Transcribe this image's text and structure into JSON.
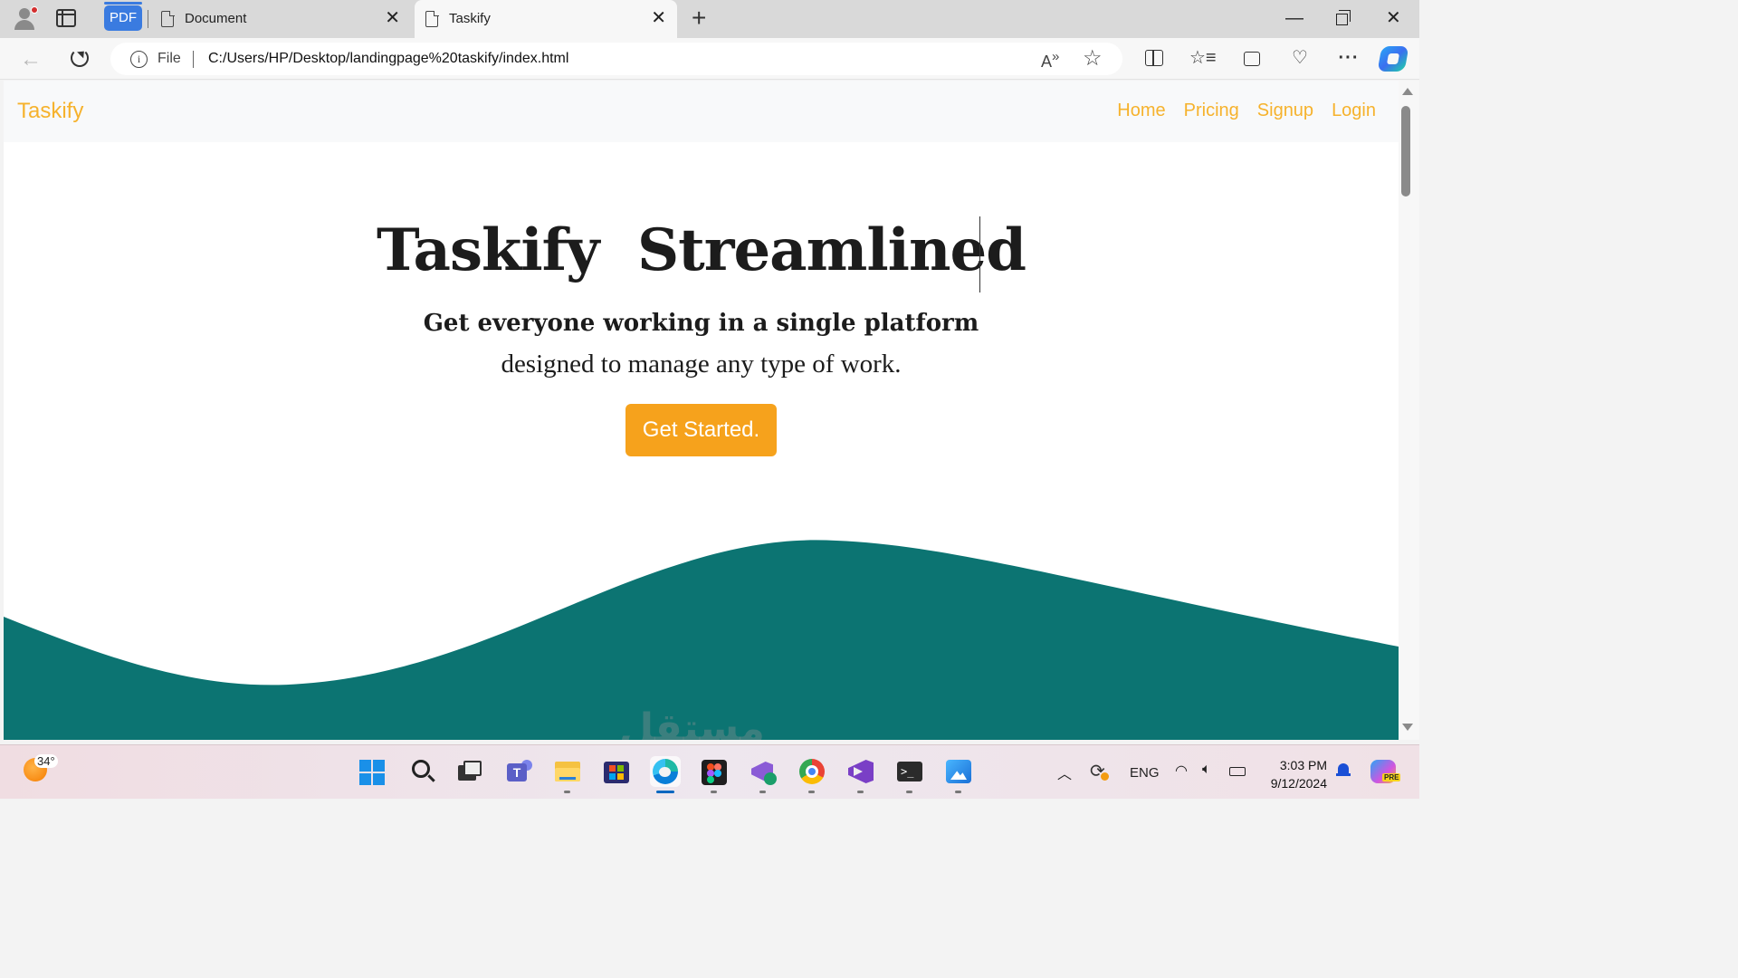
{
  "browser": {
    "pinned_tab_label": "PDF",
    "tabs": [
      {
        "title": "Document",
        "active": false
      },
      {
        "title": "Taskify",
        "active": true
      }
    ],
    "close_glyph": "✕",
    "new_tab_glyph": "+",
    "window_controls": {
      "minimize": "—",
      "close": "✕"
    },
    "address": {
      "scheme": "File",
      "url": "C:/Users/HP/Desktop/landingpage%20taskify/index.html",
      "info_glyph": "i"
    },
    "icons": [
      "back-arrow-icon",
      "reload-icon",
      "read-aloud-icon",
      "favorite-star-icon",
      "split-screen-icon",
      "favorites-icon",
      "collections-icon",
      "browser-essentials-icon",
      "more-icon",
      "copilot-icon"
    ]
  },
  "site": {
    "brand": "Taskify",
    "nav_links": [
      "Home",
      "Pricing",
      "Signup",
      "Login"
    ],
    "hero_title": "Taskify  Streamlined",
    "hero_subtitle_bold": "Get everyone working in a single platform",
    "hero_subtitle": "designed to manage any type of work.",
    "cta_label": "Get Started.",
    "colors": {
      "accent": "#f6b22c",
      "button": "#f6a21c",
      "wave": "#0c7472",
      "text": "#1c1c1c"
    }
  },
  "taskbar": {
    "weather_temp": "34°",
    "apps": [
      "start-icon",
      "search-icon",
      "task-view-icon",
      "teams-icon",
      "file-explorer-icon",
      "microsoft-store-icon",
      "edge-icon",
      "figma-icon",
      "visual-studio-installer-icon",
      "chrome-icon",
      "visual-studio-icon",
      "terminal-icon",
      "photos-icon"
    ],
    "active_app": "edge-icon",
    "language": "ENG",
    "time": "3:03 PM",
    "date": "9/12/2024",
    "copilot_badge": "PRE"
  },
  "watermark": "مستقل"
}
